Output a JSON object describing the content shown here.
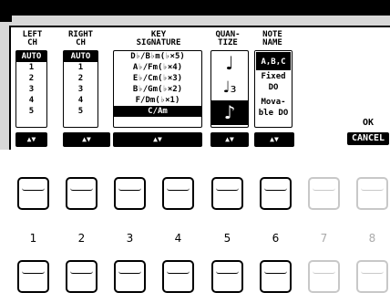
{
  "columns": {
    "left_ch": {
      "title1": "LEFT",
      "title2": "CH",
      "items": [
        "AUTO",
        "1",
        "2",
        "3",
        "4",
        "5"
      ]
    },
    "right_ch": {
      "title1": "RIGHT",
      "title2": "CH",
      "items": [
        "AUTO",
        "1",
        "2",
        "3",
        "4",
        "5"
      ]
    },
    "key_signature": {
      "title1": "KEY",
      "title2": "SIGNATURE",
      "items": [
        "D♭/B♭m(♭×5)",
        "A♭/Fm(♭×4)",
        "E♭/Cm(♭×3)",
        "B♭/Gm(♭×2)",
        "F/Dm(♭×1)",
        "C/Am"
      ]
    },
    "quantize": {
      "title1": "QUAN-",
      "title2": "TIZE",
      "notes": [
        "♩",
        "♩₃",
        "♪"
      ]
    },
    "note_name": {
      "title1": "NOTE",
      "title2": "NAME",
      "items": [
        "A,B,C",
        "Fixed",
        "DO",
        "Mova-",
        "ble DO"
      ]
    }
  },
  "arrow_label": "▲▼",
  "ok_label": "OK",
  "cancel_label": "CANCEL",
  "buttons": {
    "numbers": [
      "1",
      "2",
      "3",
      "4",
      "5",
      "6",
      "7",
      "8"
    ]
  }
}
